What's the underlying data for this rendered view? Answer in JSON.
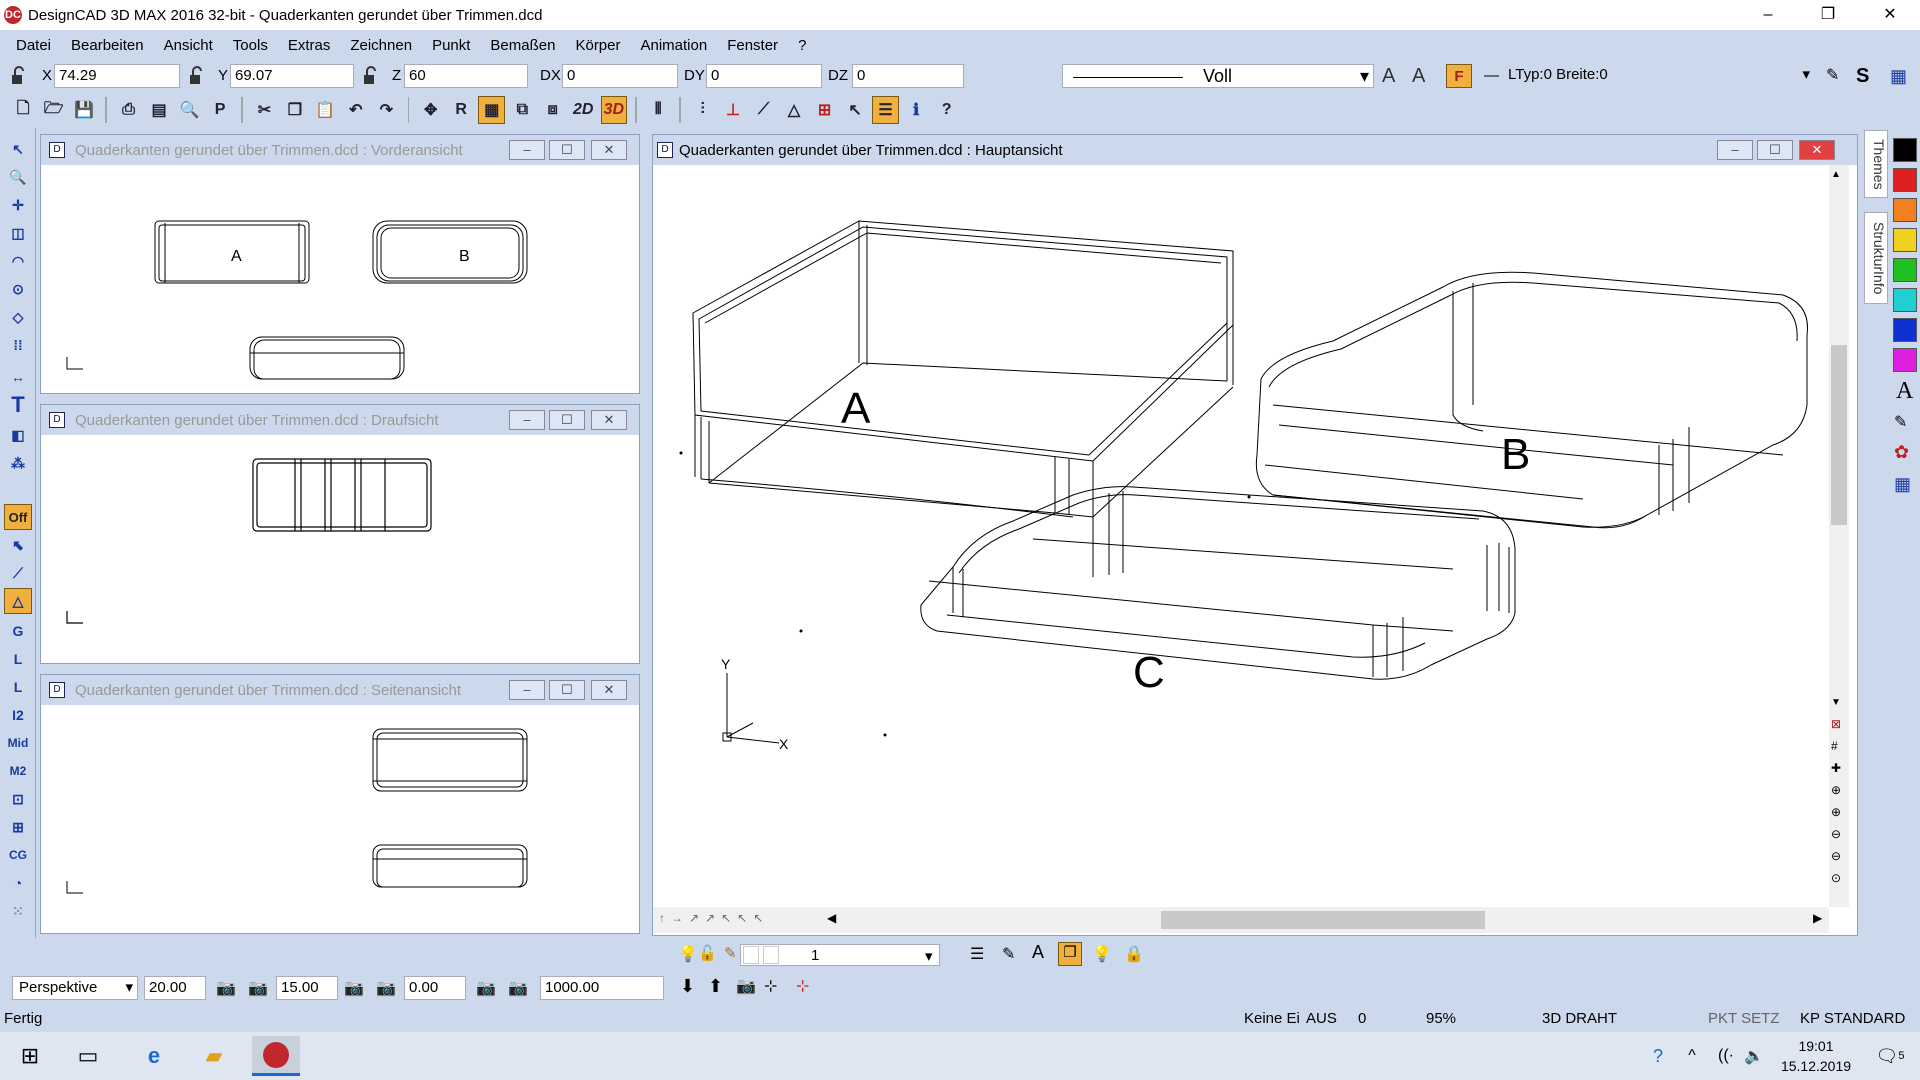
{
  "app": {
    "title": "DesignCAD 3D MAX 2016 32-bit - Quaderkanten gerundet über Trimmen.dcd",
    "logo": "DC"
  },
  "window_controls": {
    "minimize": "–",
    "restore": "❐",
    "close": "✕"
  },
  "menu": [
    "Datei",
    "Bearbeiten",
    "Ansicht",
    "Tools",
    "Extras",
    "Zeichnen",
    "Punkt",
    "Bemaßen",
    "Körper",
    "Animation",
    "Fenster",
    "?"
  ],
  "coords": {
    "x_label": "X",
    "x_value": "74.29",
    "y_label": "Y",
    "y_value": "69.07",
    "z_label": "Z",
    "z_value": "60",
    "dx_label": "DX",
    "dx_value": "0",
    "dy_label": "DY",
    "dy_value": "0",
    "dz_label": "DZ",
    "dz_value": "0"
  },
  "linestyle": {
    "name": "Voll",
    "ltyp": "LTyp:0  Breite:0"
  },
  "toolbar": {
    "mode_2d": "2D",
    "mode_3d": "3D"
  },
  "left_tools": {
    "off_label": "Off",
    "g": "G",
    "l": "L",
    "l1": "L",
    "i2": "I2",
    "mid": "Mid",
    "m2": "M2",
    "cg": "CG",
    "text_tool": "T"
  },
  "windows": {
    "front": {
      "title": "Quaderkanten gerundet über Trimmen.dcd : Vorderansicht",
      "label_a": "A",
      "label_b": "B"
    },
    "top": {
      "title": "Quaderkanten gerundet über Trimmen.dcd : Draufsicht"
    },
    "side": {
      "title": "Quaderkanten gerundet über Trimmen.dcd : Seitenansicht"
    },
    "main": {
      "title": "Quaderkanten gerundet über Trimmen.dcd : Hauptansicht",
      "label_a": "A",
      "label_b": "B",
      "label_c": "C",
      "axis_x": "X",
      "axis_y": "Y"
    }
  },
  "right_tabs": {
    "themes": "Themes",
    "struktur": "StrukturInfo"
  },
  "palette": [
    "#000000",
    "#e02020",
    "#f08020",
    "#f0d020",
    "#20c020",
    "#20d0d0",
    "#1030d0",
    "#e020e0"
  ],
  "layer_bar": {
    "layer_value": "1"
  },
  "view_bar": {
    "projection": "Perspektive",
    "val1": "20.00",
    "val2": "15.00",
    "val3": "0.00",
    "val4": "1000.00"
  },
  "status": {
    "ready": "Fertig",
    "keine": "Keine Ei",
    "aus": "AUS",
    "zero": "0",
    "zoom": "95%",
    "mode": "3D DRAHT",
    "pkt": "PKT SETZ",
    "kp": "KP STANDARD"
  },
  "taskbar": {
    "time": "19:01",
    "date": "15.12.2019",
    "notif": "5"
  }
}
